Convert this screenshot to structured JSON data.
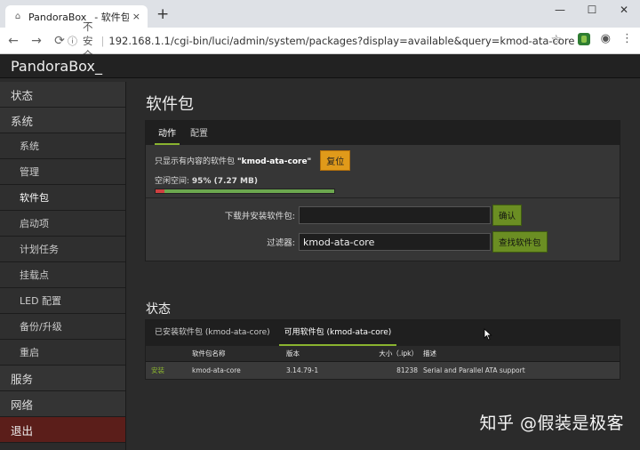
{
  "browser": {
    "tab_title": "PandoraBox_ - 软件包 - LuCI",
    "close_tab": "×",
    "new_tab": "+",
    "not_secure": "不安全",
    "url": "192.168.1.1/cgi-bin/luci/admin/system/packages?display=available&query=kmod-ata-core",
    "win_min": "—",
    "win_max": "☐",
    "win_close": "✕"
  },
  "brand": "PandoraBox_",
  "sidebar": {
    "items": [
      {
        "label": "状态",
        "type": "main"
      },
      {
        "label": "系统",
        "type": "main"
      },
      {
        "label": "系统",
        "type": "sub"
      },
      {
        "label": "管理",
        "type": "sub"
      },
      {
        "label": "软件包",
        "type": "sub"
      },
      {
        "label": "启动项",
        "type": "sub"
      },
      {
        "label": "计划任务",
        "type": "sub"
      },
      {
        "label": "挂载点",
        "type": "sub"
      },
      {
        "label": "LED 配置",
        "type": "sub"
      },
      {
        "label": "备份/升级",
        "type": "sub"
      },
      {
        "label": "重启",
        "type": "sub"
      },
      {
        "label": "服务",
        "type": "main"
      },
      {
        "label": "网络",
        "type": "main"
      },
      {
        "label": "退出",
        "type": "logout"
      }
    ]
  },
  "main": {
    "title": "软件包",
    "tabs": [
      "动作",
      "配置"
    ],
    "filter_note_prefix": "只显示有内容的软件包",
    "filter_note_query": "\"kmod-ata-core\"",
    "reset_label": "复位",
    "free_space_label": "空闲空间:",
    "free_space_value": "95% (7.27 MB)",
    "free_space_fraction": 0.95,
    "download_label": "下载并安装软件包:",
    "download_value": "",
    "confirm_label": "确认",
    "filter_label": "过滤器:",
    "filter_value": "kmod-ata-core",
    "find_label": "查找软件包"
  },
  "status": {
    "title": "状态",
    "tabs": [
      "已安装软件包 (kmod-ata-core)",
      "可用软件包 (kmod-ata-core)"
    ],
    "columns": [
      "",
      "软件包名称",
      "版本",
      "大小（.ipk）",
      "描述"
    ],
    "rows": [
      {
        "action": "安装",
        "name": "kmod-ata-core",
        "version": "3.14.79-1",
        "size": "81238",
        "desc": "Serial and Parallel ATA support"
      }
    ]
  },
  "watermark": "知乎 @假装是极客",
  "colors": {
    "accent": "#8ab32f",
    "reset": "#e09a1a",
    "logout": "#5b1e1a"
  }
}
